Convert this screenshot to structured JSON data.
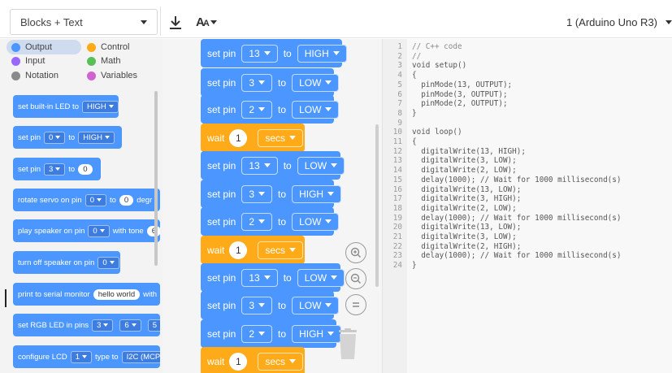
{
  "toolbar": {
    "mode_select_label": "Blocks + Text",
    "font_letter": "A",
    "font_letter_small": "A",
    "device_select_label": "1 (Arduino Uno R3)"
  },
  "categories": [
    {
      "label": "Output",
      "color": "#4c97ff"
    },
    {
      "label": "Control",
      "color": "#ffab19"
    },
    {
      "label": "Input",
      "color": "#9966ff"
    },
    {
      "label": "Math",
      "color": "#59c059"
    },
    {
      "label": "Notation",
      "color": "#8a8a8a"
    },
    {
      "label": "Variables",
      "color": "#cf63cf"
    }
  ],
  "palette_blocks": [
    {
      "parts": [
        "set built-in LED to",
        "HIGH"
      ]
    },
    {
      "parts": [
        "set pin",
        "0",
        "to",
        "HIGH"
      ]
    },
    {
      "parts": [
        "set pin",
        "3",
        "to",
        "0"
      ]
    },
    {
      "parts": [
        "rotate servo on pin",
        "0",
        "to",
        "0",
        "degr"
      ]
    },
    {
      "parts": [
        "play speaker on pin",
        "0",
        "with tone",
        "6"
      ]
    },
    {
      "parts": [
        "turn off speaker on pin",
        "0"
      ]
    },
    {
      "parts": [
        "print to serial monitor",
        "hello world",
        "with"
      ]
    },
    {
      "parts": [
        "set RGB LED in pins",
        "3",
        "6",
        "5"
      ]
    },
    {
      "parts": [
        "configure LCD",
        "1",
        "type to",
        "I2C (MCP2"
      ]
    }
  ],
  "workspace_blocks": [
    {
      "kind": "set",
      "label": "set pin",
      "pin": "13",
      "to": "to",
      "value": "HIGH"
    },
    {
      "kind": "set",
      "label": "set pin",
      "pin": "3",
      "to": "to",
      "value": "LOW"
    },
    {
      "kind": "set",
      "label": "set pin",
      "pin": "2",
      "to": "to",
      "value": "LOW"
    },
    {
      "kind": "wait",
      "label": "wait",
      "amount": "1",
      "unit": "secs"
    },
    {
      "kind": "set",
      "label": "set pin",
      "pin": "13",
      "to": "to",
      "value": "LOW"
    },
    {
      "kind": "set",
      "label": "set pin",
      "pin": "3",
      "to": "to",
      "value": "HIGH"
    },
    {
      "kind": "set",
      "label": "set pin",
      "pin": "2",
      "to": "to",
      "value": "LOW"
    },
    {
      "kind": "wait",
      "label": "wait",
      "amount": "1",
      "unit": "secs"
    },
    {
      "kind": "set",
      "label": "set pin",
      "pin": "13",
      "to": "to",
      "value": "LOW"
    },
    {
      "kind": "set",
      "label": "set pin",
      "pin": "3",
      "to": "to",
      "value": "LOW"
    },
    {
      "kind": "set",
      "label": "set pin",
      "pin": "2",
      "to": "to",
      "value": "HIGH"
    },
    {
      "kind": "wait",
      "label": "wait",
      "amount": "1",
      "unit": "secs"
    }
  ],
  "code_lines": [
    {
      "n": "1",
      "text": "// C++ code",
      "comment": true
    },
    {
      "n": "2",
      "text": "//",
      "comment": true
    },
    {
      "n": "3",
      "text": "void setup()"
    },
    {
      "n": "4",
      "text": "{"
    },
    {
      "n": "5",
      "text": "  pinMode(13, OUTPUT);"
    },
    {
      "n": "6",
      "text": "  pinMode(3, OUTPUT);"
    },
    {
      "n": "7",
      "text": "  pinMode(2, OUTPUT);"
    },
    {
      "n": "8",
      "text": "}"
    },
    {
      "n": "9",
      "text": ""
    },
    {
      "n": "10",
      "text": "void loop()"
    },
    {
      "n": "11",
      "text": "{"
    },
    {
      "n": "12",
      "text": "  digitalWrite(13, HIGH);"
    },
    {
      "n": "13",
      "text": "  digitalWrite(3, LOW);"
    },
    {
      "n": "14",
      "text": "  digitalWrite(2, LOW);"
    },
    {
      "n": "15",
      "text": "  delay(1000); // Wait for 1000 millisecond(s)"
    },
    {
      "n": "16",
      "text": "  digitalWrite(13, LOW);"
    },
    {
      "n": "17",
      "text": "  digitalWrite(3, HIGH);"
    },
    {
      "n": "18",
      "text": "  digitalWrite(2, LOW);"
    },
    {
      "n": "19",
      "text": "  delay(1000); // Wait for 1000 millisecond(s)"
    },
    {
      "n": "20",
      "text": "  digitalWrite(13, LOW);"
    },
    {
      "n": "21",
      "text": "  digitalWrite(3, LOW);"
    },
    {
      "n": "22",
      "text": "  digitalWrite(2, HIGH);"
    },
    {
      "n": "23",
      "text": "  delay(1000); // Wait for 1000 millisecond(s)"
    },
    {
      "n": "24",
      "text": "}"
    }
  ],
  "icons": {
    "download": "download-icon",
    "zoom_in": "zoom-in-icon",
    "zoom_out": "zoom-out-icon",
    "zoom_reset": "zoom-reset-icon",
    "trash": "trash-icon"
  },
  "colors": {
    "output_blue": "#4c97ff",
    "control_orange": "#ffab19"
  }
}
